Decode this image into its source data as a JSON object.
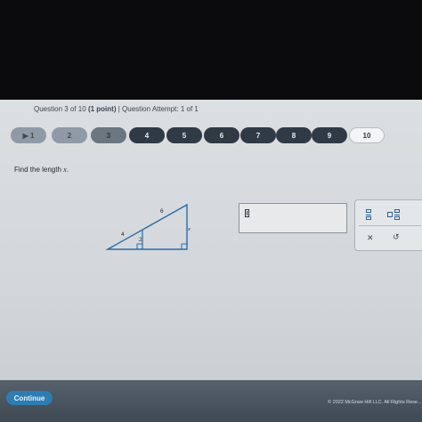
{
  "header": {
    "question_prefix": "Question 3 of 10 ",
    "points": "(1 point)",
    "separator": " | ",
    "attempt": "Question Attempt: 1 of 1"
  },
  "question_nav": [
    {
      "label": "▶ 1",
      "state": "done"
    },
    {
      "label": "2",
      "state": "done"
    },
    {
      "label": "3",
      "state": "current"
    },
    {
      "label": "4",
      "state": "todo"
    },
    {
      "label": "5",
      "state": "todo"
    },
    {
      "label": "6",
      "state": "todo"
    },
    {
      "label": "7",
      "state": "todo"
    },
    {
      "label": "8",
      "state": "todo"
    },
    {
      "label": "9",
      "state": "todo"
    },
    {
      "label": "10",
      "state": "last"
    }
  ],
  "prompt": {
    "text": "Find the length ",
    "variable": "x",
    "end": "."
  },
  "figure": {
    "hypotenuse_label": "6",
    "side_label": "x",
    "segment_label": "4",
    "altitude_label": "2"
  },
  "answer": {
    "value": ""
  },
  "math_panel": {
    "icons": [
      "fraction-icon",
      "mixed-number-icon",
      "clear-icon",
      "undo-icon"
    ],
    "clear_glyph": "✕",
    "undo_glyph": "↺"
  },
  "footer": {
    "continue_label": "Continue",
    "copyright": "© 2022 McGraw Hill LLC. All Rights Rese..."
  },
  "colors": {
    "accent": "#2d7db3",
    "nav_dark": "#2f3a44",
    "math_icon": "#2f5f98"
  }
}
